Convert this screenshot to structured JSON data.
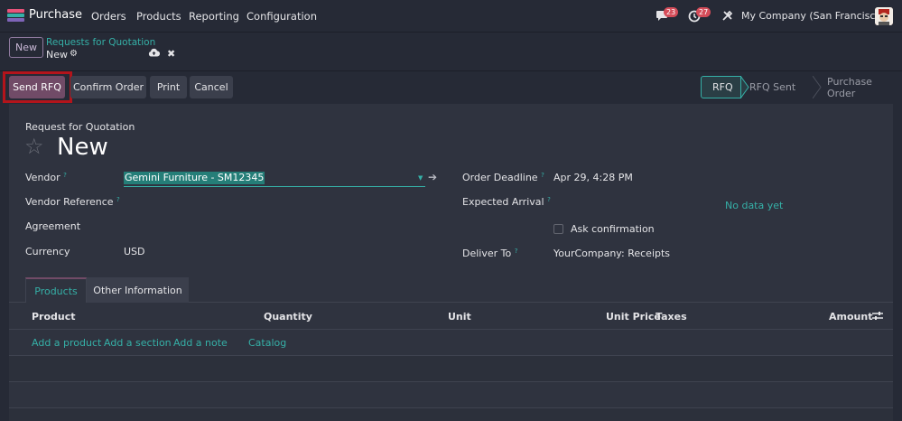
{
  "navbar": {
    "app_name": "Purchase",
    "app_icon_colors": [
      "#e8537a",
      "#35b0a7",
      "#7e64b8"
    ],
    "menu": [
      "Orders",
      "Products",
      "Reporting",
      "Configuration"
    ],
    "messages_badge": "23",
    "activities_badge": "27",
    "company": "My Company (San Francisco)"
  },
  "breadcrumb": {
    "new_button": "New",
    "parent": "Requests for Quotation",
    "current": "New"
  },
  "actions": {
    "send_rfq": "Send RFQ",
    "confirm_order": "Confirm Order",
    "print": "Print",
    "cancel": "Cancel"
  },
  "status": {
    "stages": [
      "RFQ",
      "RFQ Sent",
      "Purchase Order"
    ],
    "active": "RFQ"
  },
  "form": {
    "doc_type": "Request for Quotation",
    "title": "New",
    "vendor_label": "Vendor",
    "vendor_value": "Gemini Furniture - SM12345",
    "vendor_ref_label": "Vendor Reference",
    "agreement_label": "Agreement",
    "currency_label": "Currency",
    "currency_value": "USD",
    "order_deadline_label": "Order Deadline",
    "order_deadline_value": "Apr 29, 4:28 PM",
    "expected_arrival_label": "Expected Arrival",
    "no_data": "No data yet",
    "ask_confirmation": "Ask confirmation",
    "deliver_to_label": "Deliver To",
    "deliver_to_value": "YourCompany: Receipts"
  },
  "tabs": [
    "Products",
    "Other Information"
  ],
  "lines_table": {
    "columns": [
      "Product",
      "Quantity",
      "Unit",
      "Unit Price",
      "Taxes",
      "Amount"
    ],
    "add_links": [
      "Add a product",
      "Add a section",
      "Add a note",
      "Catalog"
    ]
  },
  "colors": {
    "brand": "#714b67",
    "accent": "#35b0a7",
    "badge": "#d44c59",
    "highlight": "#b3141b"
  }
}
